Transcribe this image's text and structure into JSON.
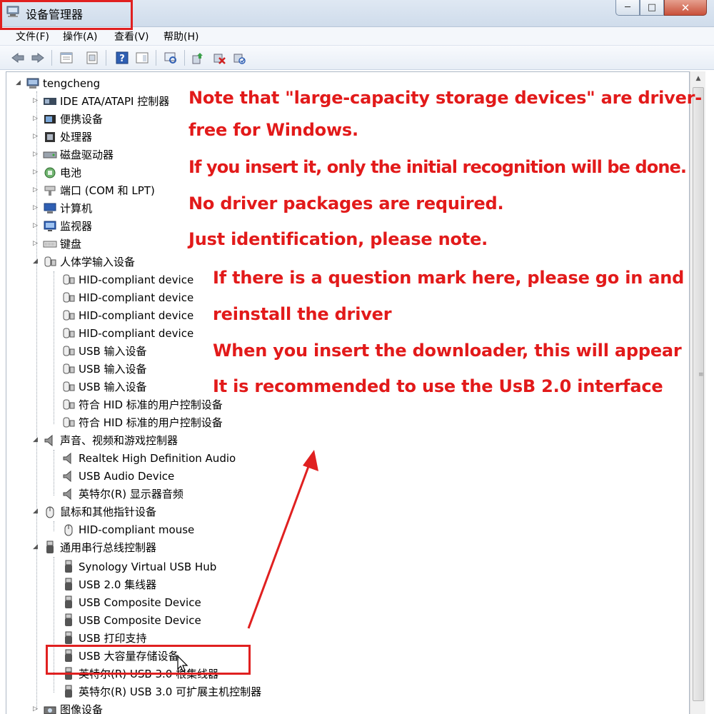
{
  "window": {
    "title": "设备管理器",
    "controls": {
      "minimize": "─",
      "maximize": "□",
      "close": "✕"
    }
  },
  "menubar": {
    "items": [
      "文件(F)",
      "操作(A)",
      "查看(V)",
      "帮助(H)"
    ]
  },
  "toolbar": {
    "icons": [
      "back-icon",
      "forward-icon",
      "properties-icon",
      "driver-icon",
      "help-icon",
      "panel-icon",
      "scan-icon",
      "update-driver-icon",
      "uninstall-icon",
      "enable-icon"
    ]
  },
  "tree": {
    "root": "tengcheng",
    "nodes": [
      {
        "label": "IDE ATA/ATAPI 控制器",
        "state": "collapsed",
        "icon": "ide-controller-icon"
      },
      {
        "label": "便携设备",
        "state": "collapsed",
        "icon": "portable-device-icon"
      },
      {
        "label": "处理器",
        "state": "collapsed",
        "icon": "processor-icon"
      },
      {
        "label": "磁盘驱动器",
        "state": "collapsed",
        "icon": "disk-drive-icon"
      },
      {
        "label": "电池",
        "state": "collapsed",
        "icon": "battery-icon"
      },
      {
        "label": "端口 (COM 和 LPT)",
        "state": "collapsed",
        "icon": "port-icon"
      },
      {
        "label": "计算机",
        "state": "collapsed",
        "icon": "computer-icon"
      },
      {
        "label": "监视器",
        "state": "collapsed",
        "icon": "monitor-icon"
      },
      {
        "label": "键盘",
        "state": "collapsed",
        "icon": "keyboard-icon"
      },
      {
        "label": "人体学输入设备",
        "state": "expanded",
        "icon": "hid-icon",
        "children": [
          "HID-compliant device",
          "HID-compliant device",
          "HID-compliant device",
          "HID-compliant device",
          "USB 输入设备",
          "USB 输入设备",
          "USB 输入设备",
          "符合 HID 标准的用户控制设备",
          "符合 HID 标准的用户控制设备"
        ]
      },
      {
        "label": "声音、视频和游戏控制器",
        "state": "expanded",
        "icon": "speaker-icon",
        "children": [
          "Realtek High Definition Audio",
          "USB Audio Device",
          "英特尔(R) 显示器音频"
        ]
      },
      {
        "label": "鼠标和其他指针设备",
        "state": "expanded",
        "icon": "mouse-icon",
        "children": [
          "HID-compliant mouse"
        ]
      },
      {
        "label": "通用串行总线控制器",
        "state": "expanded",
        "icon": "usb-icon",
        "children": [
          "Synology Virtual USB Hub",
          "USB 2.0 集线器",
          "USB Composite Device",
          "USB Composite Device",
          "USB 打印支持",
          "USB 大容量存储设备",
          "英特尔(R) USB 3.0 根集线器",
          "英特尔(R) USB 3.0 可扩展主机控制器"
        ]
      },
      {
        "label": "图像设备",
        "state": "collapsed",
        "icon": "imaging-device-icon"
      }
    ],
    "selected_item": "USB 大容量存储设备"
  },
  "annotations": {
    "lines": [
      "Note that \"large-capacity storage devices\" are driver-",
      "free for Windows.",
      "If you insert it, only the initial recognition will be done.",
      "No driver packages are required.",
      "Just identification, please note.",
      "If there is a question mark here, please go in and",
      "reinstall the driver",
      "When you insert the downloader, this will appear",
      "It is recommended to use the UsB 2.0 interface"
    ],
    "color": "#e21a1a"
  }
}
